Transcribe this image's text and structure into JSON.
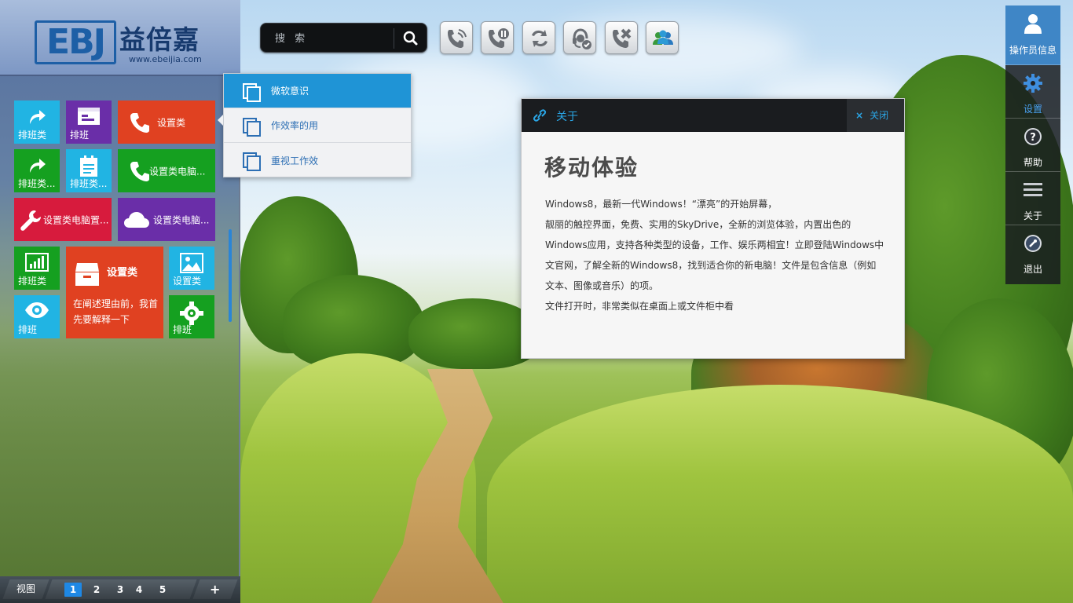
{
  "logo": {
    "mark": "EBJ",
    "name": "益倍嘉",
    "url": "www.ebeijia.com"
  },
  "tiles": [
    {
      "label": "排班类",
      "color": "#21b4e3",
      "icon": "share-arrow-icon"
    },
    {
      "label": "排班",
      "color": "#6a2ea8",
      "icon": "card-icon"
    },
    {
      "label": "设置类",
      "color": "#e04121",
      "icon": "phone-icon"
    },
    {
      "label": "排班类...",
      "color": "#15a020",
      "icon": "share-arrow-icon"
    },
    {
      "label": "排班类...",
      "color": "#21b4e3",
      "icon": "clipboard-icon"
    },
    {
      "label": "设置类电脑...",
      "color": "#15a020",
      "icon": "phone-icon"
    },
    {
      "label": "设置类电脑置...",
      "color": "#d71b3d",
      "icon": "wrench-icon"
    },
    {
      "label": "设置类电脑...",
      "color": "#6a2ea8",
      "icon": "cloud-icon"
    },
    {
      "label": "排班类",
      "color": "#15a020",
      "icon": "bar-chart-icon"
    },
    {
      "label": "设置类",
      "color": "#e04121",
      "icon": "archive-icon",
      "text": "在阐述理由前，我首先要解释一下"
    },
    {
      "label": "设置类",
      "color": "#21b4e3",
      "icon": "image-icon"
    },
    {
      "label": "排班",
      "color": "#21b4e3",
      "icon": "eye-icon"
    },
    {
      "label": "排班",
      "color": "#15a020",
      "icon": "gear-icon"
    }
  ],
  "dropdown": {
    "items": [
      {
        "label": "微软意识",
        "active": true
      },
      {
        "label": "作效率的用",
        "active": false
      },
      {
        "label": "重视工作效",
        "active": false
      }
    ]
  },
  "bottombar": {
    "view_label": "视图",
    "pages": [
      "1",
      "2",
      "3",
      "4",
      "5"
    ],
    "current_page": "1",
    "add_label": "+"
  },
  "search": {
    "placeholder": "搜 索",
    "value": ""
  },
  "toolbar": [
    {
      "icon": "phone-ring-icon"
    },
    {
      "icon": "phone-hold-icon"
    },
    {
      "icon": "phone-transfer-icon"
    },
    {
      "icon": "headset-check-icon"
    },
    {
      "icon": "phone-add-icon"
    },
    {
      "icon": "group-icon"
    }
  ],
  "dialog": {
    "title": "关于",
    "close_label": "关闭",
    "heading": "移动体验",
    "paragraphs": [
      "Windows8，最新一代Windows！“漂亮”的开始屏幕，",
      "靓丽的触控界面，免费、实用的SkyDrive，全新的浏览体验，内置出色的",
      "Windows应用，支持各种类型的设备，工作、娱乐两相宜！立即登陆Windows中",
      "文官网，了解全新的Windows8，找到适合你的新电脑！文件是包含信息（例如",
      "文本、图像或音乐）的项。",
      "文件打开时，非常类似在桌面上或文件柜中看"
    ]
  },
  "rightbar": {
    "items": [
      {
        "label": "操作员信息",
        "icon": "user-icon",
        "active": true
      },
      {
        "label": "设置",
        "icon": "gear-icon",
        "active": false
      },
      {
        "label": "帮助",
        "icon": "help-icon",
        "active": false
      },
      {
        "label": "关于",
        "icon": "menu-icon",
        "active": false
      },
      {
        "label": "退出",
        "icon": "exit-icon",
        "active": false
      }
    ]
  },
  "colors": {
    "accent": "#1f94d6",
    "dialog_title": "#2aa6e6",
    "sidebar_active": "#3f86c6"
  }
}
